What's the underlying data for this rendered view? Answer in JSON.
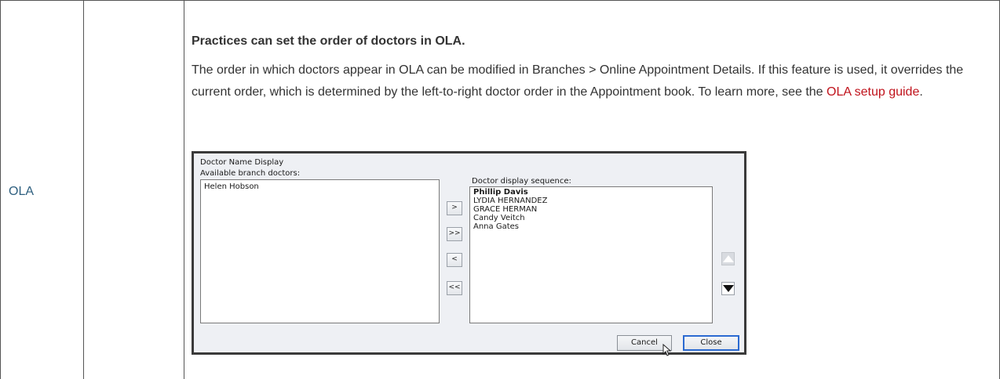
{
  "table": {
    "row_label": "OLA",
    "heading": "Practices can set the order of doctors in OLA.",
    "paragraph_before_link": "The order in which doctors appear in OLA can be modified in Branches > Online Appointment Details. If this feature is used, it overrides the current order, which is determined by the left-to-right doctor order in the Appointment book. To learn more, see the ",
    "link_text": "OLA setup guide",
    "paragraph_after_link": "."
  },
  "dialog": {
    "title": "Doctor Name Display",
    "available_label": "Available branch doctors:",
    "available_doctors": [
      "Helen Hobson"
    ],
    "sequence_label": "Doctor display sequence:",
    "sequence_doctors": [
      "Phillip Davis",
      "LYDIA HERNANDEZ",
      "GRACE HERMAN",
      "Candy Veitch",
      "Anna Gates"
    ],
    "buttons": {
      "move_right": ">",
      "move_all_right": ">>",
      "move_left": "<",
      "move_all_left": "<<",
      "cancel": "Cancel",
      "close": "Close"
    }
  }
}
